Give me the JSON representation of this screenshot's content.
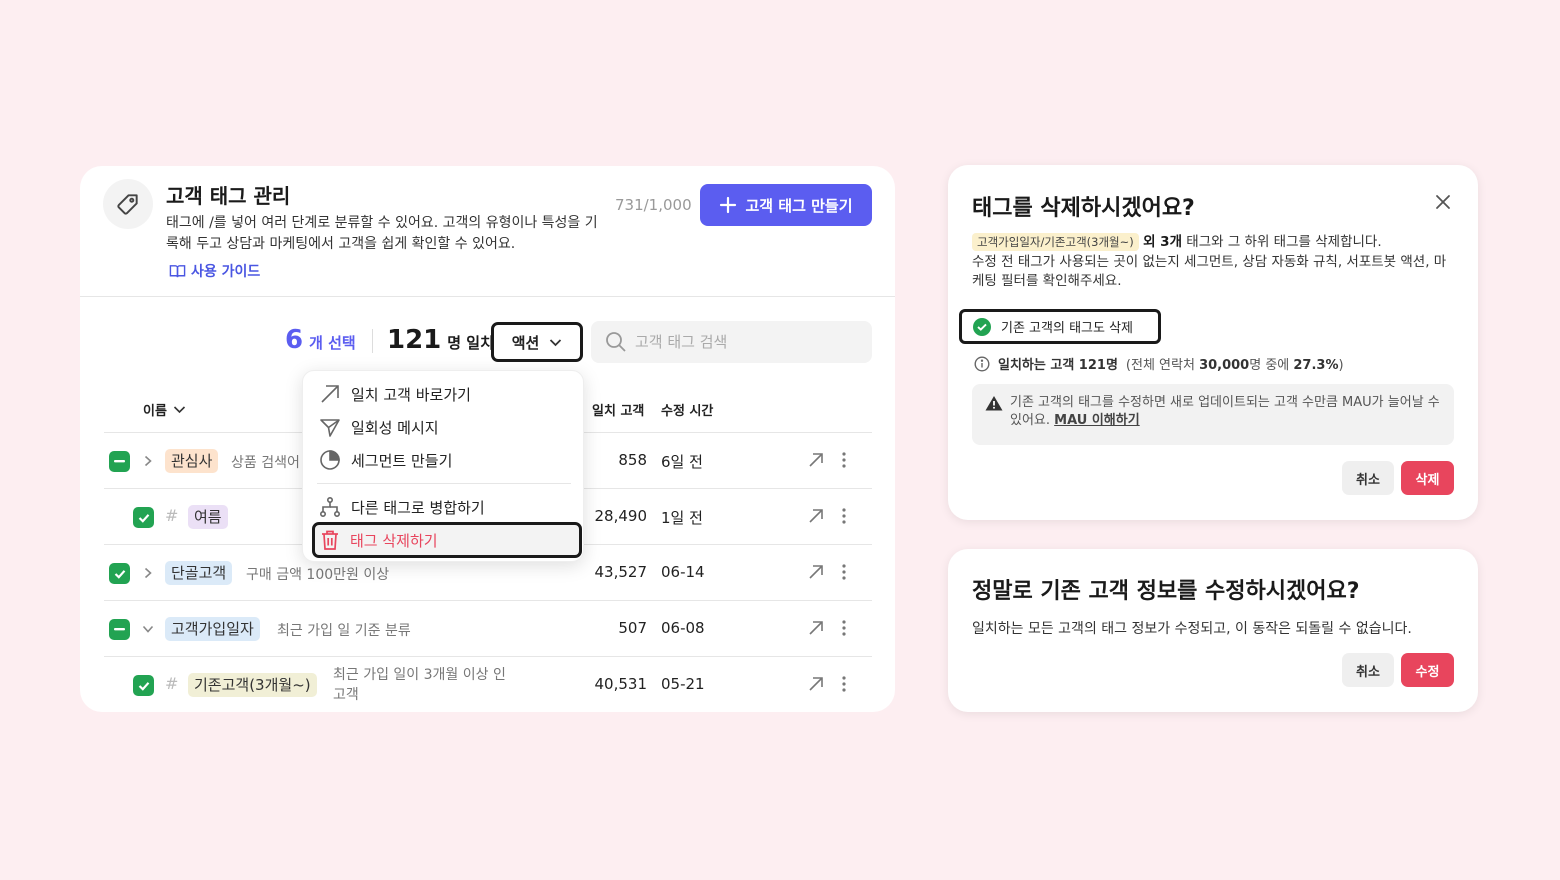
{
  "panel": {
    "title": "고객 태그 관리",
    "description": "태그에 /를 넣어 여러 단계로 분류할 수 있어요. 고객의 유형이나 특성을 기록해 두고 상담과 마케팅에서 고객을 쉽게 확인할 수 있어요.",
    "guide_link": "사용 가이드",
    "tag_count": "731/1,000",
    "create_button": "고객 태그 만들기"
  },
  "toolbar": {
    "selected_num": "6",
    "selected_label": "개 선택",
    "match_num": "121",
    "match_label": "명 일치",
    "action_button": "액션",
    "search_placeholder": "고객 태그 검색"
  },
  "table": {
    "headers": {
      "name": "이름",
      "match": "일치 고객",
      "modified": "수정 시간"
    },
    "rows": [
      {
        "tag": "관심사",
        "tag_color": "#fde3cd",
        "desc": "상품 검색어",
        "match": "858",
        "modified": "6일 전",
        "check": "partial",
        "level": 0,
        "expander": "collapsed"
      },
      {
        "tag": "여름",
        "tag_color": "#ebe0f6",
        "desc": "",
        "match": "28,490",
        "modified": "1일 전",
        "check": "checked",
        "level": 1
      },
      {
        "tag": "단골고객",
        "tag_color": "#dbeaf8",
        "desc": "구매 금액 100만원 이상",
        "match": "43,527",
        "modified": "06-14",
        "check": "checked",
        "level": 0,
        "expander": "collapsed"
      },
      {
        "tag": "고객가입일자",
        "tag_color": "#dbeaf8",
        "desc": "최근 가입 일 기준 분류",
        "match": "507",
        "modified": "06-08",
        "check": "partial",
        "level": 0,
        "expander": "expanded"
      },
      {
        "tag": "기존고객(3개월~)",
        "tag_color": "#f1efd6",
        "desc": "최근 가입 일이 3개월 이상 인 고객",
        "match": "40,531",
        "modified": "05-21",
        "check": "checked",
        "level": 1
      }
    ]
  },
  "dropdown": {
    "items": [
      {
        "label": "일치 고객 바로가기",
        "icon": "arrow-up-right-icon"
      },
      {
        "label": "일회성 메시지",
        "icon": "send-icon"
      },
      {
        "label": "세그먼트 만들기",
        "icon": "pie-chart-icon"
      },
      {
        "label": "다른 태그로 병합하기",
        "icon": "merge-icon"
      },
      {
        "label": "태그 삭제하기",
        "icon": "trash-icon"
      }
    ]
  },
  "delete_dialog": {
    "title": "태그를 삭제하시겠어요?",
    "tag_path": "고객가입일자/기존고객(3개월~)",
    "extra_count": "외 3개",
    "body_1": " 태그와 그 하위 태그를 삭제합니다.",
    "body_2": "수정 전 태그가 사용되는 곳이 없는지 세그먼트, 상담 자동화 규칙, 서포트봇 액션, 마케팅 필터를 확인해주세요.",
    "checkbox_label": "기존 고객의 태그도 삭제",
    "info_bold": "일치하는 고객 121명",
    "info_pre": "(전체 연락처 ",
    "info_total": "30,000",
    "info_mid": "명 중에 ",
    "info_pct": "27.3%",
    "info_post": ")",
    "warning": "기존 고객의 태그를 수정하면 새로 업데이트되는 고객 수만큼 MAU가 늘어날 수 있어요. ",
    "warning_link": "MAU 이해하기",
    "cancel": "취소",
    "confirm": "삭제"
  },
  "edit_dialog": {
    "title": "정말로 기존 고객 정보를 수정하시겠어요?",
    "body": "일치하는 모든 고객의 태그 정보가 수정되고, 이 동작은 되돌릴 수 없습니다.",
    "cancel": "취소",
    "confirm": "수정"
  },
  "colors": {
    "primary": "#5b5df0",
    "danger": "#e8455d",
    "check_green": "#22a352",
    "background": "#fdeef1"
  }
}
